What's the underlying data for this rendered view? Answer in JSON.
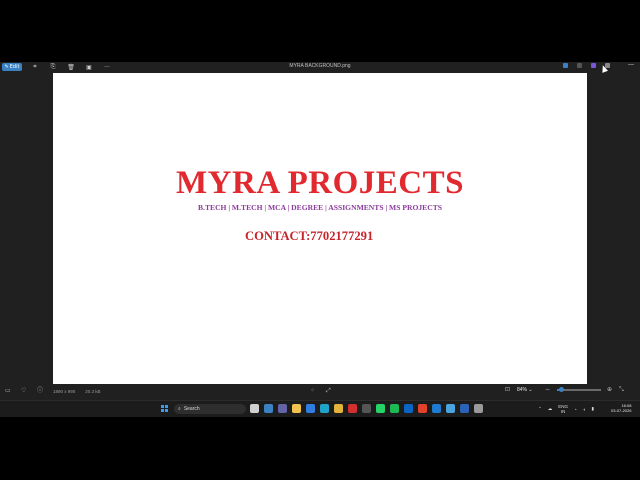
{
  "window": {
    "title": "MYRA BACKGROUND.png",
    "edit_label": "Edit"
  },
  "image": {
    "headline": "MYRA PROJECTS",
    "subline": "B.TECH | M.TECH | MCA | DEGREE | ASSIGNMENTS | MS PROJECTS",
    "contact": "CONTACT:7702177291"
  },
  "status": {
    "dimensions": "1890 x 990",
    "file_size": "20.3 kB",
    "zoom": "84%",
    "zoom_fraction": 0.1
  },
  "taskbar": {
    "search_placeholder": "Search",
    "language": "ENG",
    "region": "IN",
    "time": "16:08",
    "date": "03-07-2026"
  },
  "colors": {
    "headline": "#e12a2f",
    "subline": "#8b3b9c",
    "contact": "#c6232a",
    "accent": "#3a82c4"
  }
}
